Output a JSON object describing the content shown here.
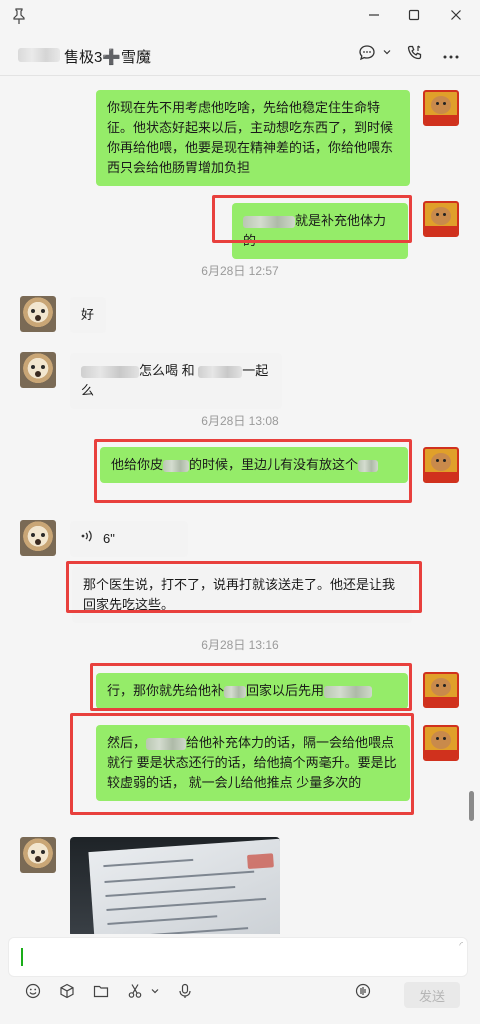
{
  "window": {
    "pin_icon": "pin-icon",
    "minimize_icon": "minimize-icon",
    "maximize_icon": "maximize-icon",
    "close_icon": "close-icon"
  },
  "header": {
    "title": "售极3➕雪魔",
    "chat_icon": "chat-bubble-icon",
    "call_icon": "phone-call-icon",
    "more_icon": "more-icon"
  },
  "messages": {
    "m1": "你现在先不用考虑他吃啥，先给他稳定住生命特征。他状态好起来以后，主动想吃东西了，到时候你再给他喂，他要是现在精神差的话，你给他喂东西只会给他肠胃增加负担",
    "m2_suffix": "就是补充他体力的",
    "ts1": "6月28日 12:57",
    "m3": "好",
    "m4_mid": "怎么喝 和",
    "m4_end": "一起么",
    "ts2": "6月28日 13:08",
    "m5_a": "他给你皮",
    "m5_b": "的时候，里边儿有没有放这个",
    "voice_duration": "6\"",
    "m6": "那个医生说，打不了，说再打就该送走了。他还是让我回家先吃这些。",
    "ts3": "6月28日 13:16",
    "m7_a": "行，那你就先给他补",
    "m7_b": "回家以后先用",
    "m8_a": "然后，",
    "m8_b": "给他补充体力的话，隔一会给他喂点就行   要是状态还行的话，给他搞个两毫升。要是比较虚弱的话，  就一会儿给他推点  少量多次的"
  },
  "input": {
    "send_label": "发送"
  },
  "colors": {
    "my_bubble": "#95ec69",
    "highlight": "#e8403d"
  }
}
